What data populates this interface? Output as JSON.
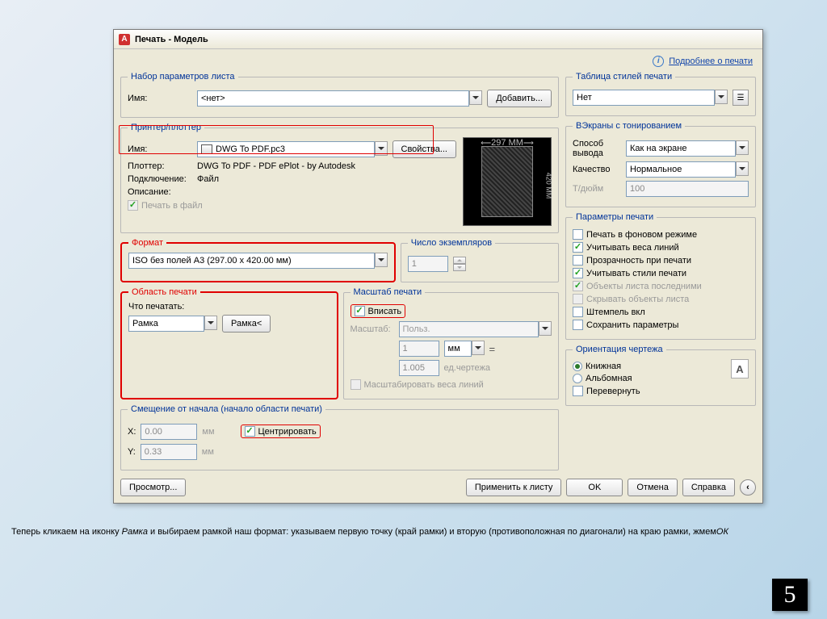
{
  "dialog": {
    "title": "Печать - Модель",
    "learn_more": "Подробнее о печати"
  },
  "pageset": {
    "legend": "Набор параметров листа",
    "name_label": "Имя:",
    "name_value": "<нет>",
    "add_btn": "Добавить..."
  },
  "printer": {
    "legend": "Принтер/плоттер",
    "name_label": "Имя:",
    "name_value": "DWG To PDF.pc3",
    "props_btn": "Свойства...",
    "plotter_label": "Плоттер:",
    "plotter_value": "DWG To PDF - PDF ePlot - by Autodesk",
    "conn_label": "Подключение:",
    "conn_value": "Файл",
    "desc_label": "Описание:",
    "print_to_file": "Печать в файл",
    "preview_w": "297 MM",
    "preview_h": "420 MM"
  },
  "format": {
    "legend": "Формат",
    "value": "ISO без полей A3 (297.00 x 420.00 мм)"
  },
  "copies": {
    "legend": "Число экземпляров",
    "value": "1"
  },
  "area": {
    "legend": "Область печати",
    "what_label": "Что печатать:",
    "what_value": "Рамка",
    "window_btn": "Рамка<"
  },
  "scale": {
    "legend": "Масштаб печати",
    "fit": "Вписать",
    "scale_label": "Масштаб:",
    "scale_value": "Польз.",
    "num": "1",
    "unit": "мм",
    "den": "1.005",
    "den_unit": "ед.чертежа",
    "scale_weights": "Масштабировать веса линий"
  },
  "offset": {
    "legend": "Смещение от начала (начало области печати)",
    "x": "X:",
    "x_val": "0.00",
    "y": "Y:",
    "y_val": "0.33",
    "mm": "мм",
    "center": "Центрировать"
  },
  "styles": {
    "legend": "Таблица стилей печати",
    "value": "Нет"
  },
  "shade": {
    "legend": "ВЭкраны с тонированием",
    "mode_label": "Способ вывода",
    "mode_value": "Как на экране",
    "quality_label": "Качество",
    "quality_value": "Нормальное",
    "dpi_label": "Т/дюйм",
    "dpi_value": "100"
  },
  "options": {
    "legend": "Параметры печати",
    "bg": "Печать в фоновом режиме",
    "weights": "Учитывать веса линий",
    "transparency": "Прозрачность при печати",
    "styles": "Учитывать стили печати",
    "last": "Объекты листа последними",
    "hide": "Скрывать объекты листа",
    "stamp": "Штемпель вкл",
    "save": "Сохранить параметры"
  },
  "orient": {
    "legend": "Ориентация чертежа",
    "portrait": "Книжная",
    "landscape": "Альбомная",
    "upside": "Перевернуть"
  },
  "footer": {
    "preview": "Просмотр...",
    "apply": "Применить к листу",
    "ok": "OK",
    "cancel": "Отмена",
    "help": "Справка"
  },
  "instruction": {
    "t1": "Теперь кликаем на иконку ",
    "t2": "Рамка",
    "t3": " и выбираем рамкой наш формат: указываем первую точку (край рамки) и вторую (противоположная по диагонали) на краю рамки, жмем",
    "t4": "ОК"
  },
  "page_number": "5"
}
